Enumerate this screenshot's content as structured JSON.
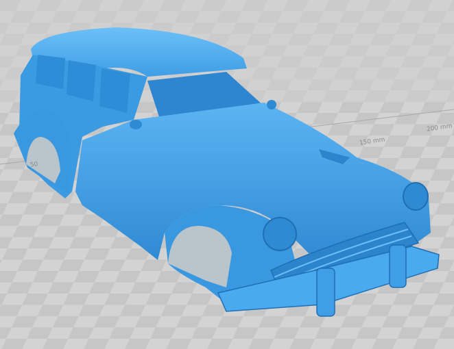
{
  "viewer": {
    "model_name": "",
    "colors": {
      "model": "#3f9ee6",
      "model_shadow": "#2a7ec6",
      "model_highlight": "#6cc0f7",
      "floor_light": "#d6d6d6",
      "floor_dark": "#c4c4c4"
    },
    "ruler_labels": [
      {
        "text": "150 mm"
      },
      {
        "text": "200 mm"
      },
      {
        "text": "50"
      }
    ]
  }
}
